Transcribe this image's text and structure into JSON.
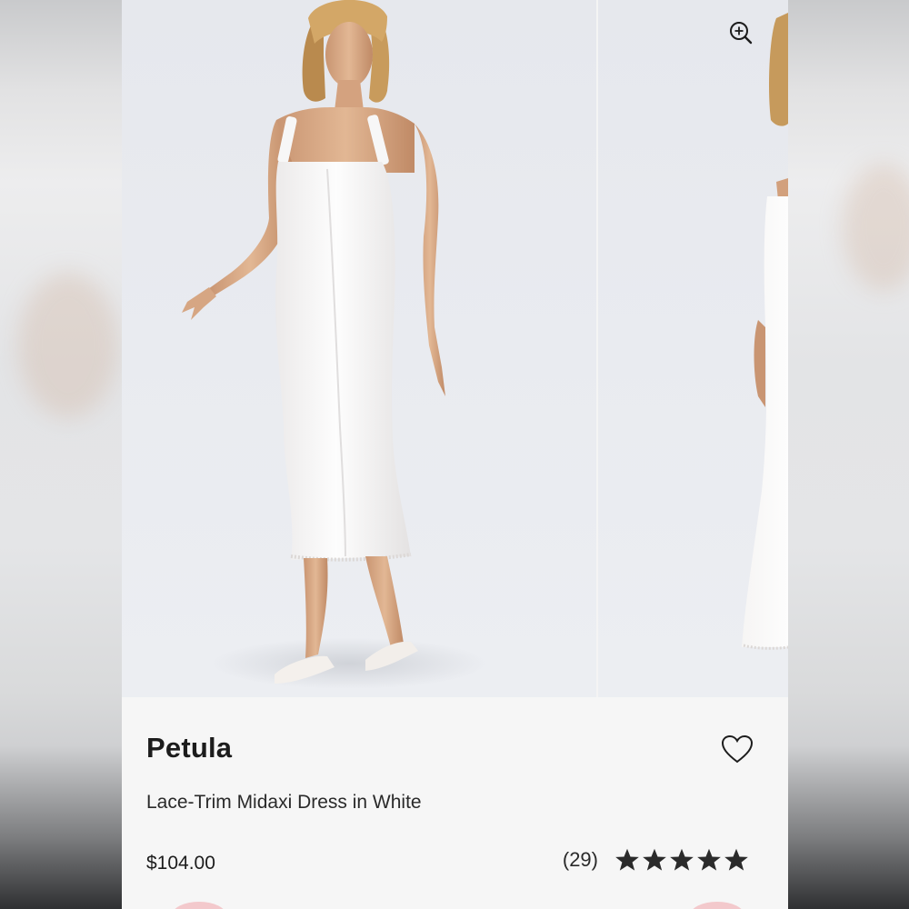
{
  "product": {
    "brand": "Petula",
    "subtitle": "Lace-Trim Midaxi Dress in White",
    "price": "$104.00",
    "review_count": "(29)",
    "rating": 5,
    "rating_max": 5
  },
  "gallery": {
    "slides": [
      {
        "alt": "Model wearing white lace-trim midaxi dress, front view"
      },
      {
        "alt": "Model wearing white lace-trim midaxi dress, side view"
      }
    ]
  },
  "icons": {
    "zoom": "zoom-in-icon",
    "wishlist": "heart-outline-icon",
    "star": "star-icon"
  },
  "colors": {
    "text": "#1c1c1c",
    "background": "#f6f6f6",
    "star": "#2b2b2b",
    "photo_bg": "#e8eaef"
  }
}
